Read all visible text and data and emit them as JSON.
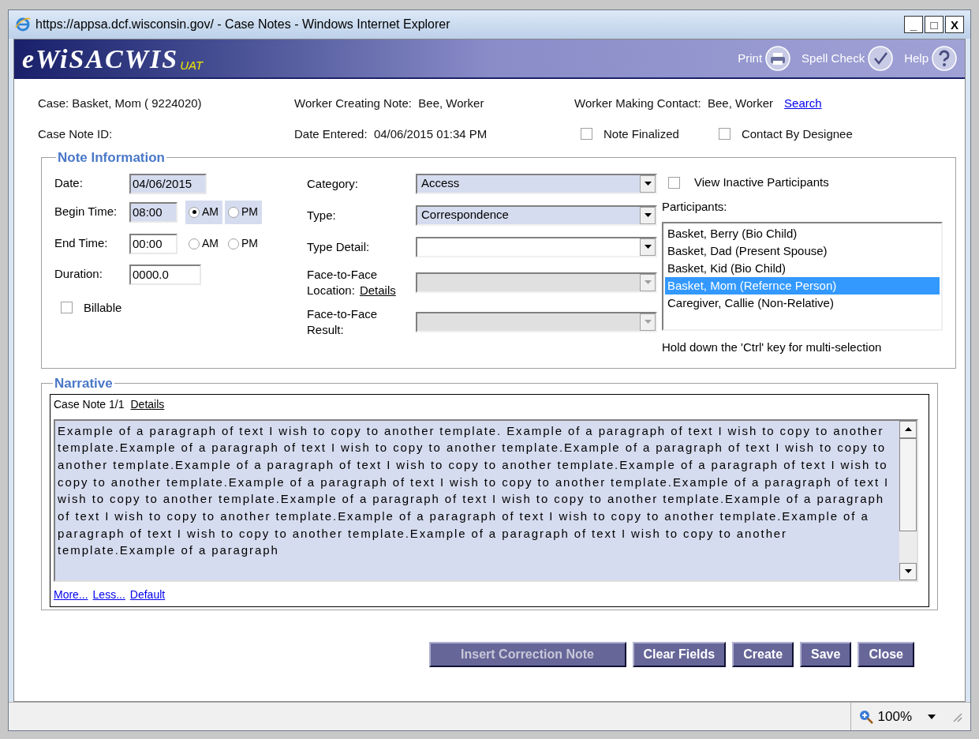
{
  "window": {
    "title": "https://appsa.dcf.wisconsin.gov/ - Case Notes - Windows Internet Explorer",
    "controls": [
      "_",
      "□",
      "X"
    ]
  },
  "header": {
    "logo": "eWiSACWIS",
    "env": "UAT",
    "actions": [
      {
        "label": "Print",
        "kind": "print"
      },
      {
        "label": "Spell Check",
        "kind": "spell"
      },
      {
        "label": "Help",
        "kind": "help"
      }
    ]
  },
  "case_info": {
    "case_label": "Case:",
    "case_value": "Basket, Mom  ( 9224020)",
    "creator_label": "Worker Creating Note:",
    "creator_value": "Bee, Worker",
    "contact_label": "Worker Making Contact:",
    "contact_value": "Bee, Worker",
    "search_link": "Search",
    "note_id_label": "Case Note ID:",
    "date_entered_label": "Date Entered:",
    "date_entered_value": "04/06/2015 01:34 PM",
    "checkboxes": [
      {
        "label": "Note Finalized",
        "checked": false
      },
      {
        "label": "Contact By Designee",
        "checked": false
      }
    ]
  },
  "note_information": {
    "legend": "Note Information",
    "date": {
      "label": "Date:",
      "value": "04/06/2015",
      "required": true
    },
    "begin_time": {
      "label": "Begin Time:",
      "value": "08:00",
      "required": true,
      "options": [
        {
          "label": "AM",
          "selected": true
        },
        {
          "label": "PM",
          "selected": false
        }
      ]
    },
    "end_time": {
      "label": "End Time:",
      "value": "00:00",
      "required": false,
      "options": [
        {
          "label": "AM",
          "selected": false
        },
        {
          "label": "PM",
          "selected": false
        }
      ]
    },
    "duration": {
      "label": "Duration:",
      "value": "0000.0"
    },
    "billable": {
      "label": "Billable",
      "checked": false
    },
    "selects": [
      {
        "label": "Category:",
        "value": "Access",
        "required": true,
        "disabled": false
      },
      {
        "label": "Type:",
        "value": "Correspondence",
        "required": true,
        "disabled": false
      },
      {
        "label": "Type Detail:",
        "required": false,
        "disabled": false
      },
      {
        "label": "Face-to-Face Location:",
        "link": "Details",
        "disabled": true
      },
      {
        "label": "Face-to-Face Result:",
        "disabled": true
      }
    ],
    "view_inactive": {
      "label": "View Inactive Participants",
      "checked": false
    },
    "participants_label": "Participants:",
    "participants": [
      {
        "name": "Basket, Berry (Bio Child)",
        "selected": false
      },
      {
        "name": "Basket, Dad (Present Spouse)",
        "selected": false
      },
      {
        "name": "Basket, Kid (Bio Child)",
        "selected": false
      },
      {
        "name": "Basket, Mom (Refernce Person)",
        "selected": true
      },
      {
        "name": "Caregiver, Callie (Non-Relative)",
        "selected": false
      }
    ],
    "hint": "Hold down the 'Ctrl' key for multi-selection"
  },
  "narrative": {
    "legend": "Narrative",
    "note_label": "Case Note 1/1",
    "details_link": "Details",
    "text": "Example of a paragraph of text I wish to copy to another template. Example of a paragraph of text I wish to copy to another template.Example of a paragraph of text I wish to copy to another template.Example of a paragraph of text I wish to copy to another template.Example of a paragraph of text I wish to copy to another template.Example of a paragraph of text I wish to copy to another template.Example of a paragraph of text I wish to copy to another template.Example of a paragraph of text I wish to copy to another template.Example of a paragraph of text I wish to copy to another template.Example of a paragraph of text I wish to copy to another template.Example of a paragraph of text I wish to copy to another template.Example of a paragraph of text I wish to copy to another template.Example of a paragraph of text I wish to copy to another template.Example of a paragraph",
    "links": [
      "More...",
      "Less...",
      "Default"
    ]
  },
  "buttons": [
    {
      "label": "Insert Correction Note",
      "disabled": true
    },
    {
      "label": "Clear Fields",
      "disabled": false
    },
    {
      "label": "Create",
      "disabled": false
    },
    {
      "label": "Save",
      "disabled": false
    },
    {
      "label": "Close",
      "disabled": false
    }
  ],
  "status_bar": {
    "zoom": "100%"
  }
}
